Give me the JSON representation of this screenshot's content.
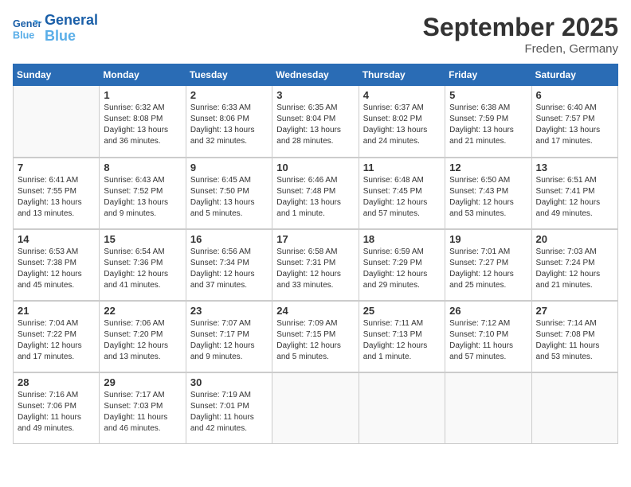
{
  "logo": {
    "line1": "General",
    "line2": "Blue"
  },
  "title": "September 2025",
  "subtitle": "Freden, Germany",
  "days_of_week": [
    "Sunday",
    "Monday",
    "Tuesday",
    "Wednesday",
    "Thursday",
    "Friday",
    "Saturday"
  ],
  "weeks": [
    [
      {
        "day": "",
        "info": ""
      },
      {
        "day": "1",
        "info": "Sunrise: 6:32 AM\nSunset: 8:08 PM\nDaylight: 13 hours\nand 36 minutes."
      },
      {
        "day": "2",
        "info": "Sunrise: 6:33 AM\nSunset: 8:06 PM\nDaylight: 13 hours\nand 32 minutes."
      },
      {
        "day": "3",
        "info": "Sunrise: 6:35 AM\nSunset: 8:04 PM\nDaylight: 13 hours\nand 28 minutes."
      },
      {
        "day": "4",
        "info": "Sunrise: 6:37 AM\nSunset: 8:02 PM\nDaylight: 13 hours\nand 24 minutes."
      },
      {
        "day": "5",
        "info": "Sunrise: 6:38 AM\nSunset: 7:59 PM\nDaylight: 13 hours\nand 21 minutes."
      },
      {
        "day": "6",
        "info": "Sunrise: 6:40 AM\nSunset: 7:57 PM\nDaylight: 13 hours\nand 17 minutes."
      }
    ],
    [
      {
        "day": "7",
        "info": "Sunrise: 6:41 AM\nSunset: 7:55 PM\nDaylight: 13 hours\nand 13 minutes."
      },
      {
        "day": "8",
        "info": "Sunrise: 6:43 AM\nSunset: 7:52 PM\nDaylight: 13 hours\nand 9 minutes."
      },
      {
        "day": "9",
        "info": "Sunrise: 6:45 AM\nSunset: 7:50 PM\nDaylight: 13 hours\nand 5 minutes."
      },
      {
        "day": "10",
        "info": "Sunrise: 6:46 AM\nSunset: 7:48 PM\nDaylight: 13 hours\nand 1 minute."
      },
      {
        "day": "11",
        "info": "Sunrise: 6:48 AM\nSunset: 7:45 PM\nDaylight: 12 hours\nand 57 minutes."
      },
      {
        "day": "12",
        "info": "Sunrise: 6:50 AM\nSunset: 7:43 PM\nDaylight: 12 hours\nand 53 minutes."
      },
      {
        "day": "13",
        "info": "Sunrise: 6:51 AM\nSunset: 7:41 PM\nDaylight: 12 hours\nand 49 minutes."
      }
    ],
    [
      {
        "day": "14",
        "info": "Sunrise: 6:53 AM\nSunset: 7:38 PM\nDaylight: 12 hours\nand 45 minutes."
      },
      {
        "day": "15",
        "info": "Sunrise: 6:54 AM\nSunset: 7:36 PM\nDaylight: 12 hours\nand 41 minutes."
      },
      {
        "day": "16",
        "info": "Sunrise: 6:56 AM\nSunset: 7:34 PM\nDaylight: 12 hours\nand 37 minutes."
      },
      {
        "day": "17",
        "info": "Sunrise: 6:58 AM\nSunset: 7:31 PM\nDaylight: 12 hours\nand 33 minutes."
      },
      {
        "day": "18",
        "info": "Sunrise: 6:59 AM\nSunset: 7:29 PM\nDaylight: 12 hours\nand 29 minutes."
      },
      {
        "day": "19",
        "info": "Sunrise: 7:01 AM\nSunset: 7:27 PM\nDaylight: 12 hours\nand 25 minutes."
      },
      {
        "day": "20",
        "info": "Sunrise: 7:03 AM\nSunset: 7:24 PM\nDaylight: 12 hours\nand 21 minutes."
      }
    ],
    [
      {
        "day": "21",
        "info": "Sunrise: 7:04 AM\nSunset: 7:22 PM\nDaylight: 12 hours\nand 17 minutes."
      },
      {
        "day": "22",
        "info": "Sunrise: 7:06 AM\nSunset: 7:20 PM\nDaylight: 12 hours\nand 13 minutes."
      },
      {
        "day": "23",
        "info": "Sunrise: 7:07 AM\nSunset: 7:17 PM\nDaylight: 12 hours\nand 9 minutes."
      },
      {
        "day": "24",
        "info": "Sunrise: 7:09 AM\nSunset: 7:15 PM\nDaylight: 12 hours\nand 5 minutes."
      },
      {
        "day": "25",
        "info": "Sunrise: 7:11 AM\nSunset: 7:13 PM\nDaylight: 12 hours\nand 1 minute."
      },
      {
        "day": "26",
        "info": "Sunrise: 7:12 AM\nSunset: 7:10 PM\nDaylight: 11 hours\nand 57 minutes."
      },
      {
        "day": "27",
        "info": "Sunrise: 7:14 AM\nSunset: 7:08 PM\nDaylight: 11 hours\nand 53 minutes."
      }
    ],
    [
      {
        "day": "28",
        "info": "Sunrise: 7:16 AM\nSunset: 7:06 PM\nDaylight: 11 hours\nand 49 minutes."
      },
      {
        "day": "29",
        "info": "Sunrise: 7:17 AM\nSunset: 7:03 PM\nDaylight: 11 hours\nand 46 minutes."
      },
      {
        "day": "30",
        "info": "Sunrise: 7:19 AM\nSunset: 7:01 PM\nDaylight: 11 hours\nand 42 minutes."
      },
      {
        "day": "",
        "info": ""
      },
      {
        "day": "",
        "info": ""
      },
      {
        "day": "",
        "info": ""
      },
      {
        "day": "",
        "info": ""
      }
    ]
  ]
}
